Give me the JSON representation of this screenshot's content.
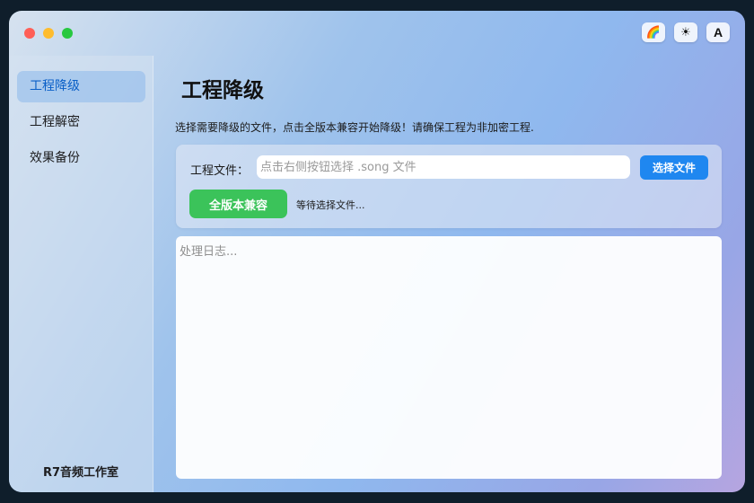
{
  "window": {
    "controls": [
      "close",
      "minimize",
      "zoom"
    ],
    "top_buttons": [
      {
        "icon": "rainbow-icon",
        "glyph": "🌈"
      },
      {
        "icon": "sun-icon",
        "glyph": "☀"
      },
      {
        "icon": "font-icon",
        "glyph": "A"
      }
    ]
  },
  "sidebar": {
    "items": [
      {
        "label": "工程降级",
        "active": true
      },
      {
        "label": "工程解密",
        "active": false
      },
      {
        "label": "效果备份",
        "active": false
      }
    ],
    "footer": "R7音频工作室"
  },
  "main": {
    "title": "工程降级",
    "description": "选择需要降级的文件，点击全版本兼容开始降级！请确保工程为非加密工程.",
    "file_label": "工程文件：",
    "file_input": {
      "value": "",
      "placeholder": "点击右侧按钮选择 .song 文件"
    },
    "choose_button": "选择文件",
    "compat_button": "全版本兼容",
    "status": "等待选择文件...",
    "log": {
      "value": "",
      "placeholder": "处理日志..."
    }
  },
  "colors": {
    "accent_blue": "#1f87f0",
    "accent_green": "#3bc35a",
    "active_text": "#0a5fc7"
  }
}
